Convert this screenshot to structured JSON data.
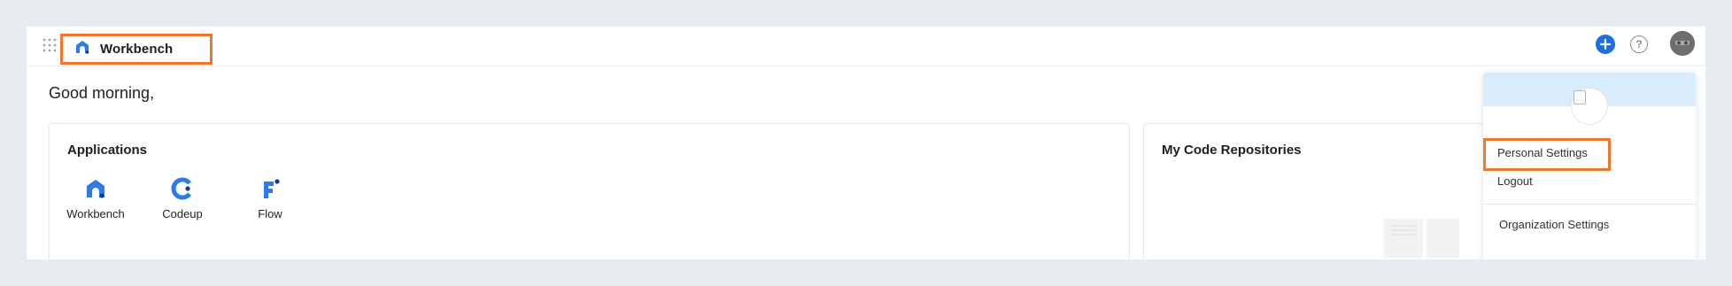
{
  "header": {
    "brand_title": "Workbench",
    "icons": {
      "apps_grid": "apps-grid-icon",
      "create": "plus-icon",
      "help": "help-icon",
      "help_glyph": "?",
      "avatar": "user-avatar"
    }
  },
  "greeting": "Good morning,",
  "applications": {
    "title": "Applications",
    "items": [
      {
        "label": "Workbench",
        "icon": "workbench-icon"
      },
      {
        "label": "Codeup",
        "icon": "codeup-icon"
      },
      {
        "label": "Flow",
        "icon": "flow-icon"
      }
    ]
  },
  "repositories": {
    "title": "My Code Repositories"
  },
  "user_menu": {
    "items": {
      "personal_settings": "Personal Settings",
      "logout": "Logout",
      "organization_settings": "Organization Settings"
    }
  },
  "colors": {
    "accent_blue": "#1b6fe0",
    "highlight_orange": "#f0772e",
    "menu_banner": "#d9ecfb"
  }
}
